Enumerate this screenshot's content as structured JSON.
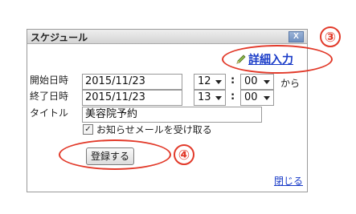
{
  "dialog": {
    "title": "スケジュール",
    "close_glyph": "X",
    "detail_link": "詳細入力",
    "start_label": "開始日時",
    "start_date": "2015/11/23",
    "start_hour": "12",
    "start_minute": "00",
    "from_text": "から",
    "end_label": "終了日時",
    "end_date": "2015/11/23",
    "end_hour": "13",
    "end_minute": "00",
    "colon": ":",
    "title_label": "タイトル",
    "title_value": "美容院予約",
    "notify_label": "お知らせメールを受け取る",
    "notify_checked": true,
    "register_button": "登録する",
    "close_link": "閉じる"
  },
  "annotations": {
    "marker_3": "③",
    "marker_4": "④",
    "color": "#e23a2a"
  }
}
